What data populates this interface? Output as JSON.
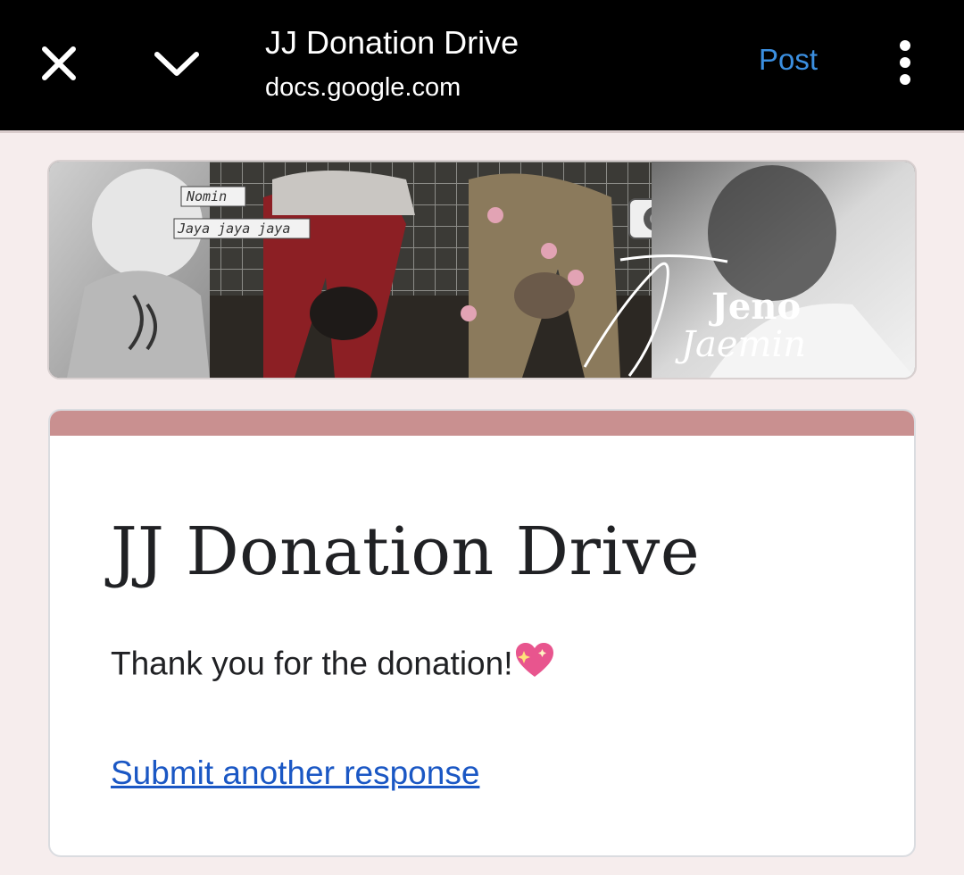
{
  "topbar": {
    "title": "JJ Donation Drive",
    "url": "docs.google.com",
    "post_label": "Post",
    "close_icon": "close-icon",
    "collapse_icon": "chevron-down-icon",
    "more_icon": "more-vert-icon"
  },
  "banner": {
    "caption_1": "Nomin",
    "caption_2": "Jaya jaya jaya",
    "name_1": "Jeno",
    "name_2": "Jaemin"
  },
  "form": {
    "title": "JJ Donation Drive",
    "confirmation": "Thank you for the donation!",
    "emoji": "sparkling-heart",
    "submit_another": "Submit another response"
  },
  "colors": {
    "accent": "#c99090",
    "link": "#1a57c4",
    "post": "#3b8fe0",
    "background": "#f6eded"
  }
}
